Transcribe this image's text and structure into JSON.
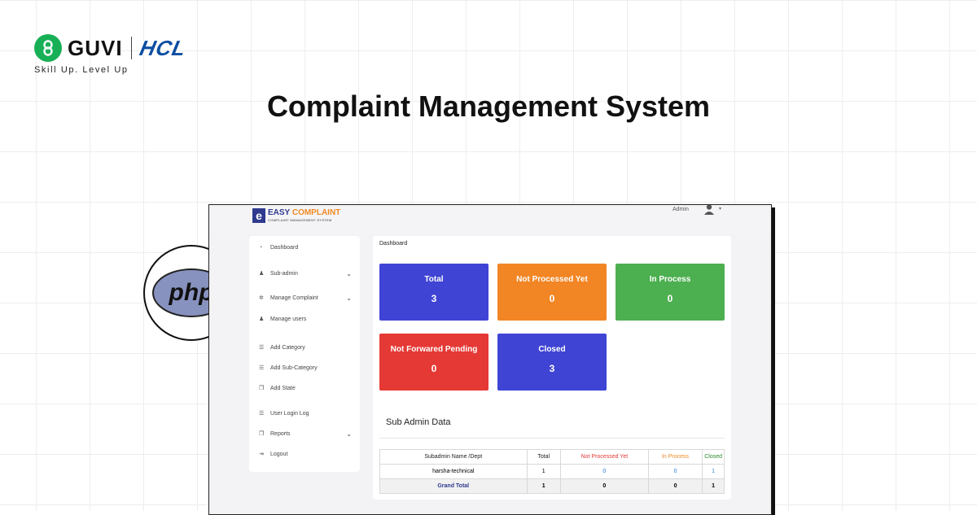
{
  "brand": {
    "guvi": "GUVI",
    "hcl": "HCL",
    "tagline": "Skill Up. Level Up"
  },
  "title": "Complaint Management System",
  "php_badge": "php",
  "app": {
    "logo": {
      "e": "e",
      "easy": "EASY",
      "complaint": "COMPLAINT",
      "subtitle": "COMPLAINT MANAGEMENT SYSTEM"
    },
    "admin_label": "Admin",
    "sidebar": [
      {
        "label": "Dashboard",
        "icon": "dashboard-icon"
      },
      {
        "label": "Sub-admin",
        "icon": "users-icon",
        "chevron": true
      },
      {
        "label": "Manage Complaint",
        "icon": "gear-icon",
        "chevron": true
      },
      {
        "label": "Manage users",
        "icon": "users-icon"
      },
      {
        "label": "Add Category",
        "icon": "list-icon"
      },
      {
        "label": "Add Sub-Category",
        "icon": "list-icon"
      },
      {
        "label": "Add State",
        "icon": "copy-icon"
      },
      {
        "label": "User Login Log",
        "icon": "list-icon"
      },
      {
        "label": "Reports",
        "icon": "copy-icon",
        "chevron": true
      },
      {
        "label": "Logout",
        "icon": "logout-icon"
      }
    ],
    "breadcrumb": "Dashboard",
    "cards": [
      {
        "label": "Total",
        "value": "3",
        "color": "#3f44d4"
      },
      {
        "label": "Not Processed Yet",
        "value": "0",
        "color": "#f28524"
      },
      {
        "label": "In Process",
        "value": "0",
        "color": "#4caf50"
      },
      {
        "label": "Not Forwared Pending",
        "value": "0",
        "color": "#e53935"
      },
      {
        "label": "Closed",
        "value": "3",
        "color": "#3f44d4"
      }
    ],
    "sub_admin": {
      "title": "Sub Admin Data",
      "headers": [
        "Subadmin Name /Dept",
        "Total",
        "Not Processed Yet",
        "In Process",
        "Closed"
      ],
      "rows": [
        [
          "harsha-technical",
          "1",
          "0",
          "0",
          "1"
        ]
      ],
      "grand_total": [
        "Grand Total",
        "1",
        "0",
        "0",
        "1"
      ]
    }
  }
}
